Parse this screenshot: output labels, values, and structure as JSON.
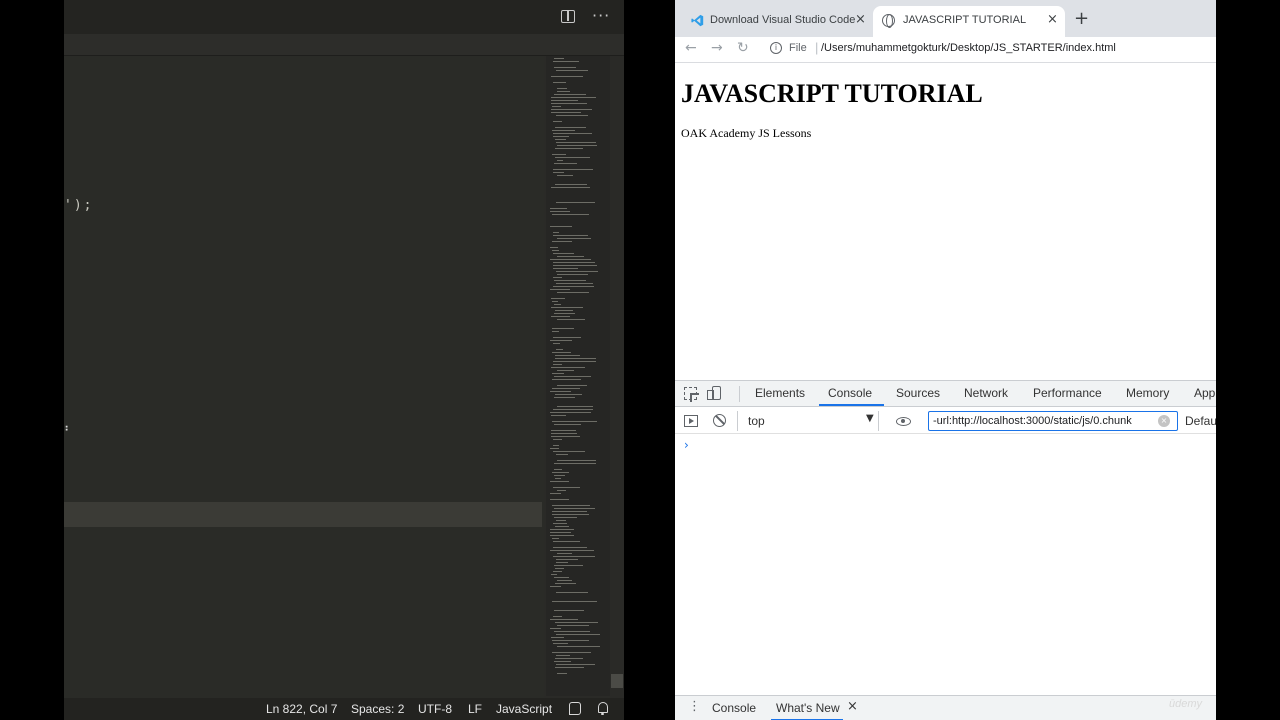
{
  "vscode": {
    "code_fragment": "');",
    "cursor_glyph": "⠃",
    "statusbar": {
      "position": "Ln 822, Col 7",
      "spaces": "Spaces: 2",
      "encoding": "UTF-8",
      "eol": "LF",
      "language": "JavaScript"
    }
  },
  "chrome": {
    "tabs": [
      {
        "label": "Download Visual Studio Code",
        "close": "×"
      },
      {
        "label": "JAVASCRIPT TUTORIAL",
        "close": "×"
      }
    ],
    "new_tab": "+",
    "toolbar": {
      "back": "←",
      "forward": "→",
      "reload": "↻",
      "info": "i",
      "scheme": "File",
      "separator": "|",
      "url": "/Users/muhammetgokturk/Desktop/JS_STARTER/index.html"
    },
    "page": {
      "heading": "JAVASCRIPT TUTORIAL",
      "paragraph": "OAK Academy JS Lessons"
    }
  },
  "devtools": {
    "tabs": [
      "Elements",
      "Console",
      "Sources",
      "Network",
      "Performance",
      "Memory",
      "App"
    ],
    "context": "top",
    "context_arrow": "▼",
    "filter_value": "-url:http://localhost:3000/static/js/0.chunk",
    "filter_clear": "×",
    "levels": "Default",
    "prompt": "›",
    "drawer": {
      "menu": "⋮",
      "tabs": [
        "Console",
        "What's New"
      ],
      "close": "×"
    },
    "watermark": "ūdemy"
  }
}
